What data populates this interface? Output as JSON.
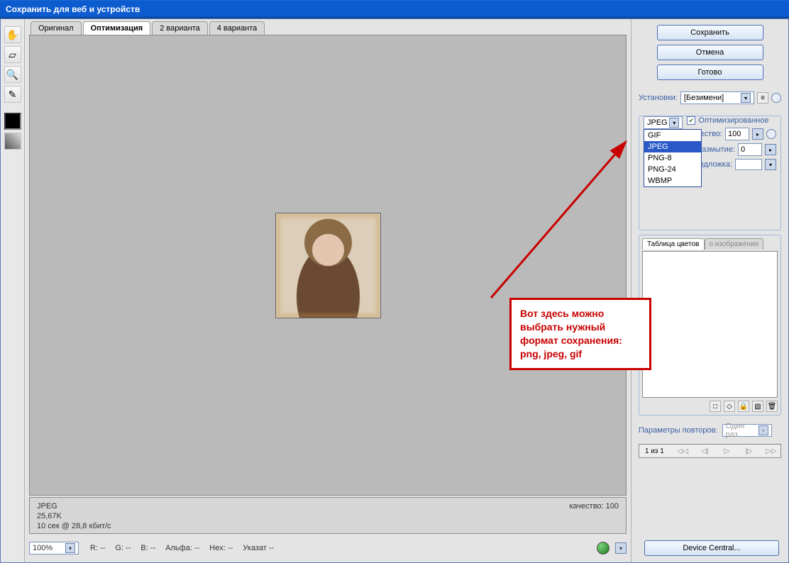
{
  "window": {
    "title": "Сохранить для веб и устройств"
  },
  "tools": {
    "hand": "hand-icon",
    "slice": "slice-icon",
    "zoom": "zoom-icon",
    "eyedropper": "eyedropper-icon",
    "fg_color": "#000000",
    "gradient": "gradient-icon"
  },
  "tabs": [
    {
      "label": "Оригинал",
      "active": false
    },
    {
      "label": "Оптимизация",
      "active": true
    },
    {
      "label": "2 варианта",
      "active": false
    },
    {
      "label": "4 варианта",
      "active": false
    }
  ],
  "status": {
    "format": "JPEG",
    "size": "25,67K",
    "time": "10 сек @ 28,8 кбит/с",
    "quality_label": "качество: 100"
  },
  "footer": {
    "zoom": "100%",
    "readouts": {
      "r": "R:   --",
      "g": "G:   --",
      "b": "B:   --",
      "alpha": "Альфа:   --",
      "hex": "Hex:   --",
      "index": "Указат   --"
    }
  },
  "right": {
    "buttons": {
      "save": "Сохранить",
      "cancel": "Отмена",
      "done": "Готово"
    },
    "preset_label": "Установки:",
    "preset_value": "[Безимени]",
    "format": {
      "selected": "JPEG",
      "options": [
        "GIF",
        "JPEG",
        "PNG-8",
        "PNG-24",
        "WBMP"
      ]
    },
    "optimized_label": "Оптимизированное",
    "optimized_checked": true,
    "quality_label": "Качество:",
    "quality_value": "100",
    "blur_label": "Размытие:",
    "blur_value": "0",
    "matte_label": "Подложка:",
    "colortable": {
      "tab1": "Таблица цветов",
      "tab2": "о изображения"
    },
    "repeat_label": "Параметры повторов:",
    "repeat_value": "Один раз",
    "frame_counter": "1 из 1",
    "device_central": "Device Central..."
  },
  "annotation": {
    "text": "Вот здесь можно выбрать нужный формат сохранения: png, jpeg, gif"
  }
}
